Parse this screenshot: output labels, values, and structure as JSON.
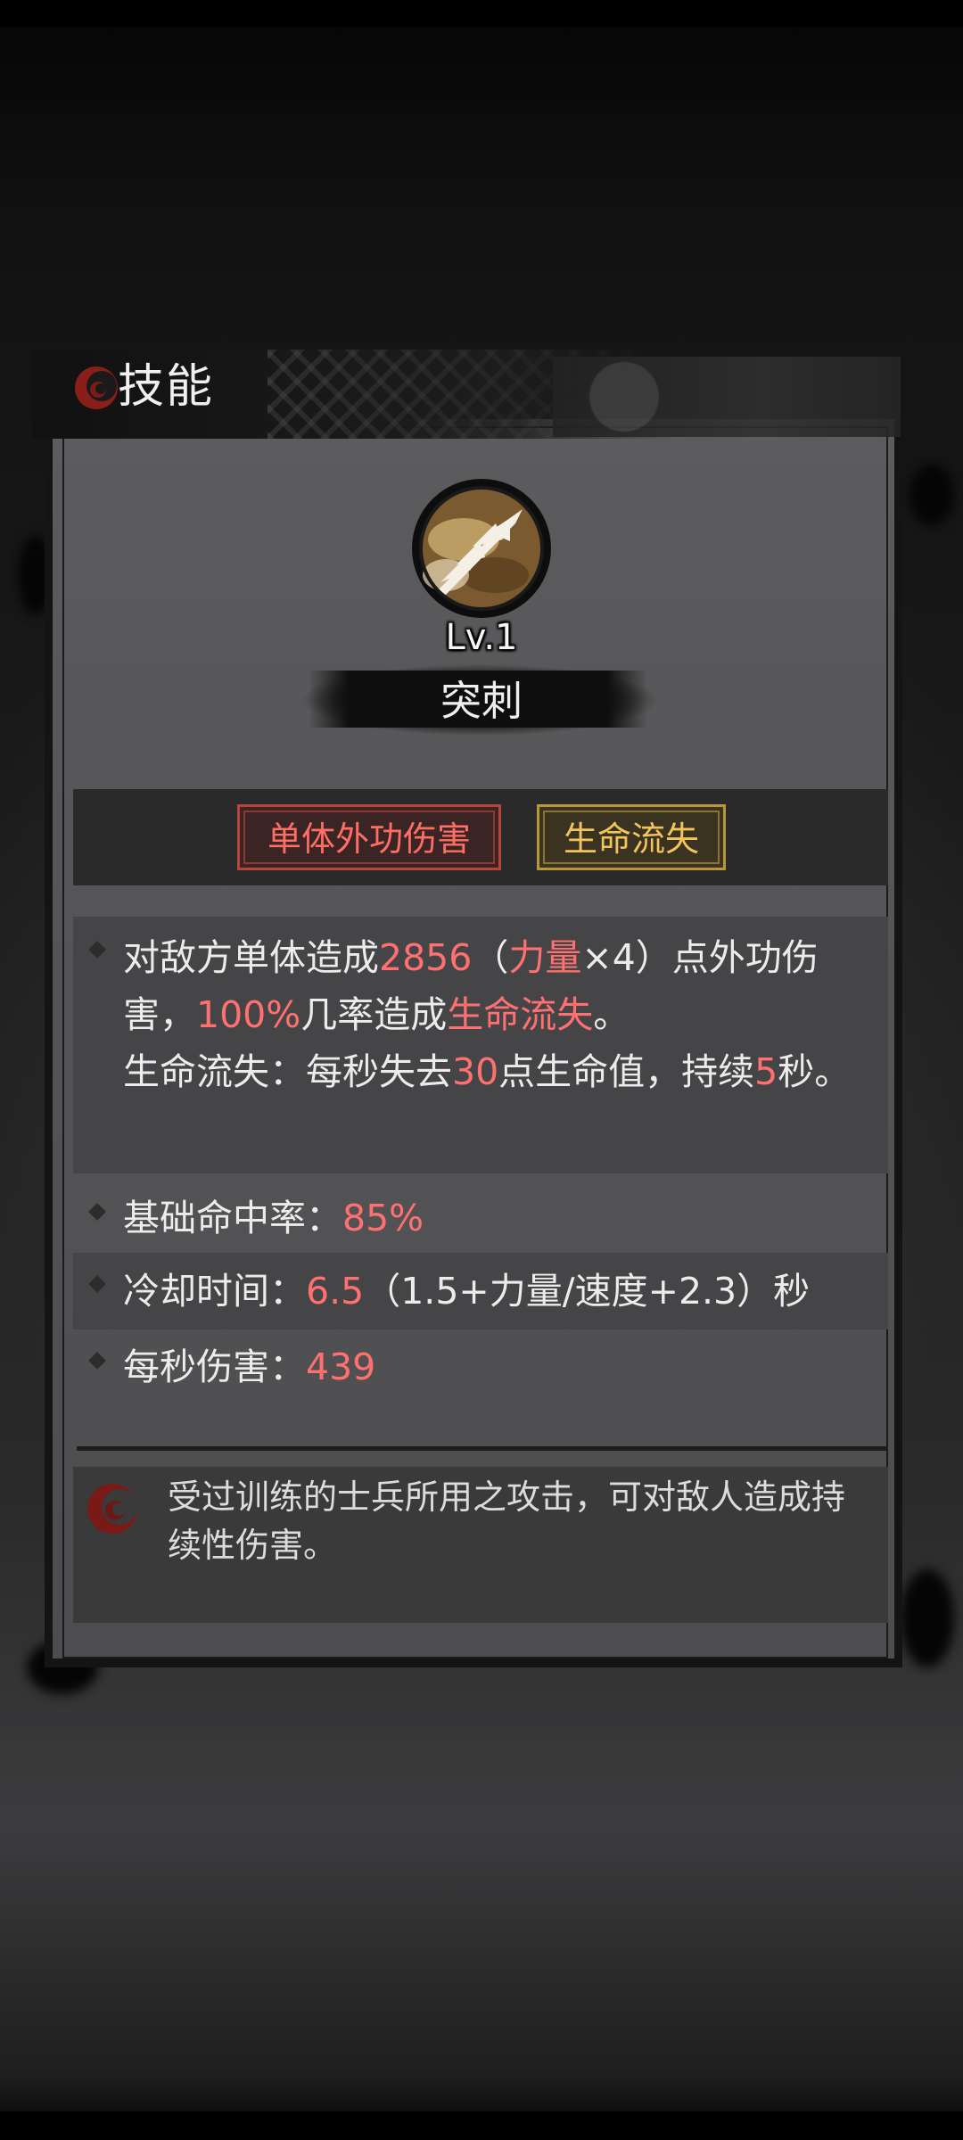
{
  "header": {
    "title": "技能",
    "icon": "crescent-swirl-icon"
  },
  "skill": {
    "icon": "thrust-slash-icon",
    "level": "Lv.1",
    "name": "突刺"
  },
  "tags": [
    {
      "label": "单体外功伤害",
      "color": "#ff6e64"
    },
    {
      "label": "生命流失",
      "color": "#f1c45d"
    }
  ],
  "details": {
    "effect": {
      "p1": "对敌方单体造成",
      "damage": "2856",
      "p2": "（",
      "stat": "力量",
      "p3": "×4）点外功伤害，",
      "chance": "100%",
      "p4": "几率造成",
      "status": "生命流失",
      "p5": "。",
      "p6": "生命流失：每秒失去",
      "loss": "30",
      "p7": "点生命值，持续",
      "duration": "5",
      "p8": "秒。"
    },
    "hit_rate": {
      "label": "基础命中率：",
      "value": "85%"
    },
    "cooldown": {
      "label": "冷却时间：",
      "value": "6.5",
      "formula": "（1.5+力量/速度+2.3）秒"
    },
    "dps": {
      "label": "每秒伤害：",
      "value": "439"
    }
  },
  "flavor": {
    "icon": "crescent-swirl-icon",
    "text": "受过训练的士兵所用之攻击，可对敌人造成持续性伤害。"
  },
  "colors": {
    "highlight_red": "#ff7070",
    "tag_gold": "#f1c45d"
  }
}
